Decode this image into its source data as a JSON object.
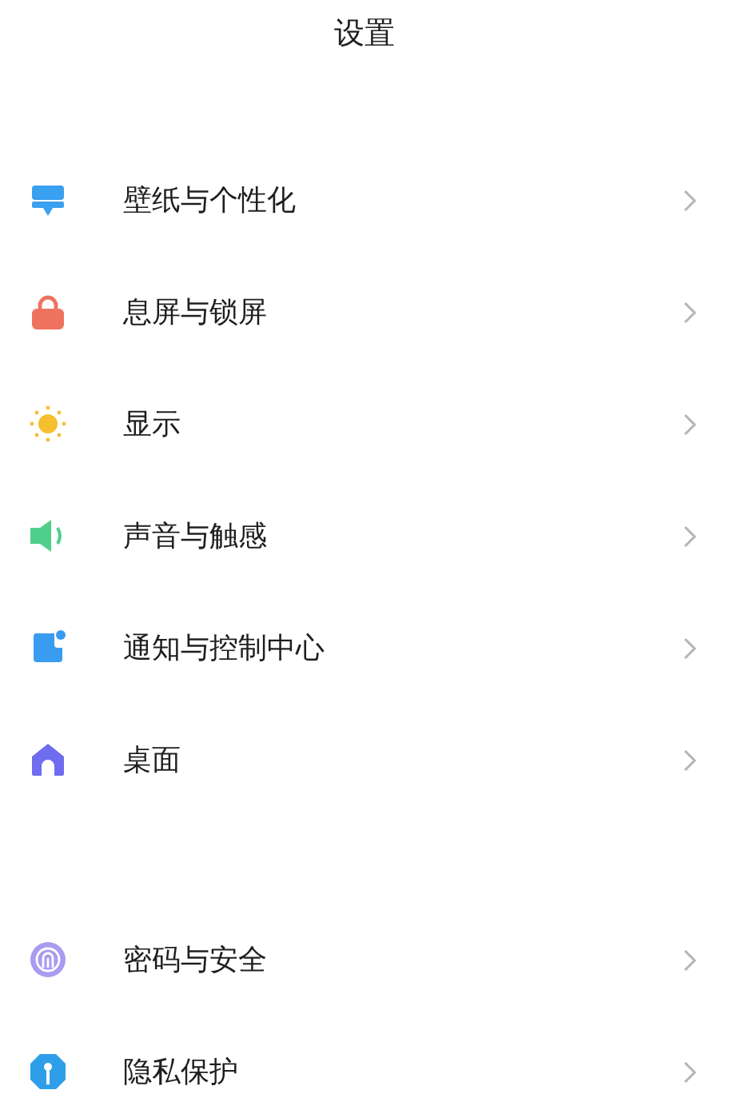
{
  "title": "设置",
  "groups": [
    {
      "items": [
        {
          "label": "壁纸与个性化"
        },
        {
          "label": "息屏与锁屏"
        },
        {
          "label": "显示"
        },
        {
          "label": "声音与触感"
        },
        {
          "label": "通知与控制中心"
        },
        {
          "label": "桌面"
        }
      ]
    },
    {
      "items": [
        {
          "label": "密码与安全"
        },
        {
          "label": "隐私保护"
        }
      ]
    }
  ]
}
